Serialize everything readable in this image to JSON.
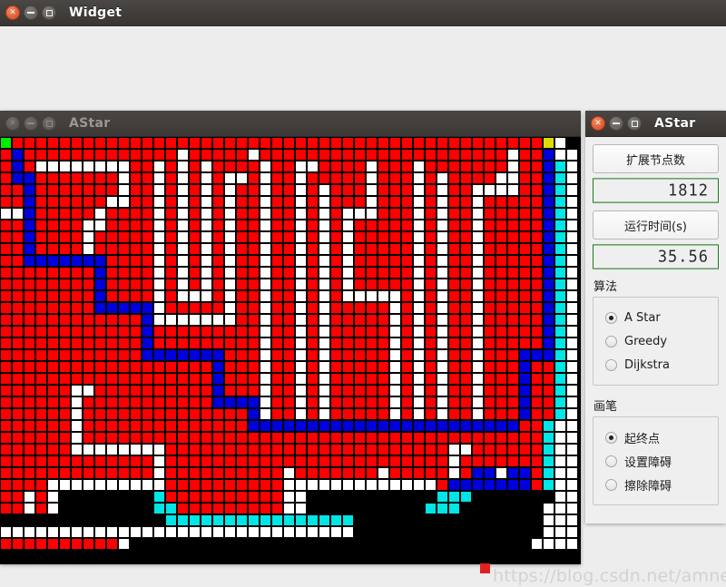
{
  "outer_window": {
    "title": "Widget",
    "buttons": {
      "close": "close-icon",
      "minimize": "minimize-icon",
      "maximize": "maximize-icon"
    }
  },
  "maze_window": {
    "title": "AStar",
    "active": false
  },
  "panel_window": {
    "title": "AStar",
    "active": true,
    "expanded_nodes_button": "扩展节点数",
    "expanded_nodes_value": "1812",
    "runtime_button": "运行时间(s)",
    "runtime_value": "35.56",
    "algorithm_group_label": "算法",
    "algorithm_options": [
      {
        "label": "A Star",
        "selected": true
      },
      {
        "label": "Greedy",
        "selected": false
      },
      {
        "label": "Dijkstra",
        "selected": false
      }
    ],
    "brush_group_label": "画笔",
    "brush_options": [
      {
        "label": "起终点",
        "selected": true
      },
      {
        "label": "设置障碍",
        "selected": false
      },
      {
        "label": "擦除障碍",
        "selected": false
      }
    ]
  },
  "watermark": {
    "text": "https://blog.csdn.net/amnesiagreen"
  },
  "grid": {
    "cols": 49,
    "rows": 36,
    "cell": 13,
    "colors": {
      "obstacle": "#ff0000",
      "free": "#ffffff",
      "path": "#0000dd",
      "visited": "#00e5e5",
      "start": "#00ee00",
      "goal": "#dddd00",
      "background": "#000000",
      "gridline": "#000000"
    },
    "legend": {
      "start_cell": [
        0,
        0
      ],
      "goal_cell": [
        47,
        0
      ]
    },
    "map": [
      "SRRRRRRRRRRRRRRRRRRRRRRRRRRRRRRRRRRRRRRRRRRRRRG.",
      "RPRRRRRRRRRRRRR.RRRRR.RRRRRRRRRRRRRRRRRRRRR.RRP..",
      "RPR........RR.R.R.RRRR.RR..RRRR.RRR.RRRRRRR.RRPV.",
      "RPPRRRRRRR.RR.R.R.R..R.RR.RRRRR.RRR.R.RRRR..RRPV.",
      "RRPRRRRRRR.RR.R.R.R.RR.RR.R.RRR.RRR.R.RR....RRPV.",
      "RRPRRRRRR..RR.R.R.R.RR.RR.R.RRR.RRR.R.RR.RRRRRPV.",
      "..PRRRRR.RRRR.R.R.R.RR.RR.R.R...RRR.R.RR.RRRRRPV.",
      "RRPRRRR..RRRR.R.R.R.RR.RR.R.R.RRRRR.R.RR.RRRRRPV.",
      "RRPRRRR.RRRRR.R.R.R.RR.RR.R.R.RRRRR.R.RR.RRRRRPV.",
      "RRPRRRR.RRRRR.R.R.R.RR.RR.R.R.RRRRR.R.RR.RRRRRPV.",
      "RRPPPPPPPRRRR.R.R.R.RR.RR.R.R.RRRRR.R.RR.RRRRRPV.",
      "RRRRRRRRPRRRR.R.R.R.RR.RR.R.R.RRRRR.R.RR.RRRRRPV.",
      "RRRRRRRRPRRRR.R.R.R.RR.RR.R.R.RRRRR.R.RR.RRRRRPV.",
      "RRRRRRRRPRRRR.R...R.RR.RR.R.R.....R.R.RR.RRRRRPV.",
      "RRRRRRRRPPPPP.RRRRR.RR.RR.R.RRRRR.R.R.RR.RRRRRPV.",
      "RRRRRRRRRRRRP.......RR.RR.R.RRRRR.R.R.RR.RRRRRPV.",
      "RRRRRRRRRRRRPRRRRRRRRR.RR.R.RRRRR.R.R.RR.RRRRRPV.",
      "RRRRRRRRRRRRPRRRRRRRRR.RR.R.RRRRR.R.R.RR.RRRRRPV.",
      "RRRRRRRRRRRRPPPPPPPRRR.RR.R.RRRRR.R.R.RR.RRRPPPV.",
      "RRRRRRRRRRRRRRRRRRPRRR.RR.R.RRRRR.R.R.RR.RRRPRRV.",
      "RRRRRRRRRRRRRRRRRRPRRR.RR.R.RRRRR.R.R.RR.RRRPRRV.",
      "RRRRRR..RRRRRRRRRRPRRR.RR.R.RRRRR.R.R.RR.RRRPRRV.",
      "RRRRRR.RRRRRRRRRRRPPPP.RR.R.RRRRR.R.R.RR.RRRPRRV.",
      "RRRRRR.RRRRRRRRRRRRRRP.RR.R.RRRRR.R.R.RR.RRRPRRV.",
      "RRRRRR.RRRRRRRRRRRRRRPPPPPPPPPPPPPPPPPPPPPPPRRV..",
      "RRRRRR.RRRRRRRRRRRRRRRRRRRRRRRRRRRRRRRRRRRRRRRV..",
      "RRRRRR........RRRRRRRRRRRRRRRRRRRRRRRR..RRRRRRV..",
      "RRRRRRRRRRRRR.RRRRRRRRRRRRRRRRRRRRRRRR.RRRRRRRV..",
      "RRRRRRRRRRRRR.RRRRRRRRRR.RRRRRRR.RRRRR.RPP.PPRV..",
      "RRRR..........RRRRRRRRRR.............RPPPPPPPRV..",
      "RR.R.BBBBBBBBVRRRRRRRRRR..BBBBBBBBBBBVVVBBBBBBB..",
      "RR.R.BBBBBBBBVVRRRRRRRRR..BBBBBBBBBBVVVBBBBBBB...",
      "BBBBBBBBBBBBBBVVVVVVVVVVVVVVVVBBBBBBBBBBBBBBBB...",
      "..............................BBBBBBBBBBBBBBBB...",
      "RRRRRRRRRR.BBBBBBBBBBBBBBBBBBBBBBBBBBBBBBBBBB...."
    ]
  }
}
